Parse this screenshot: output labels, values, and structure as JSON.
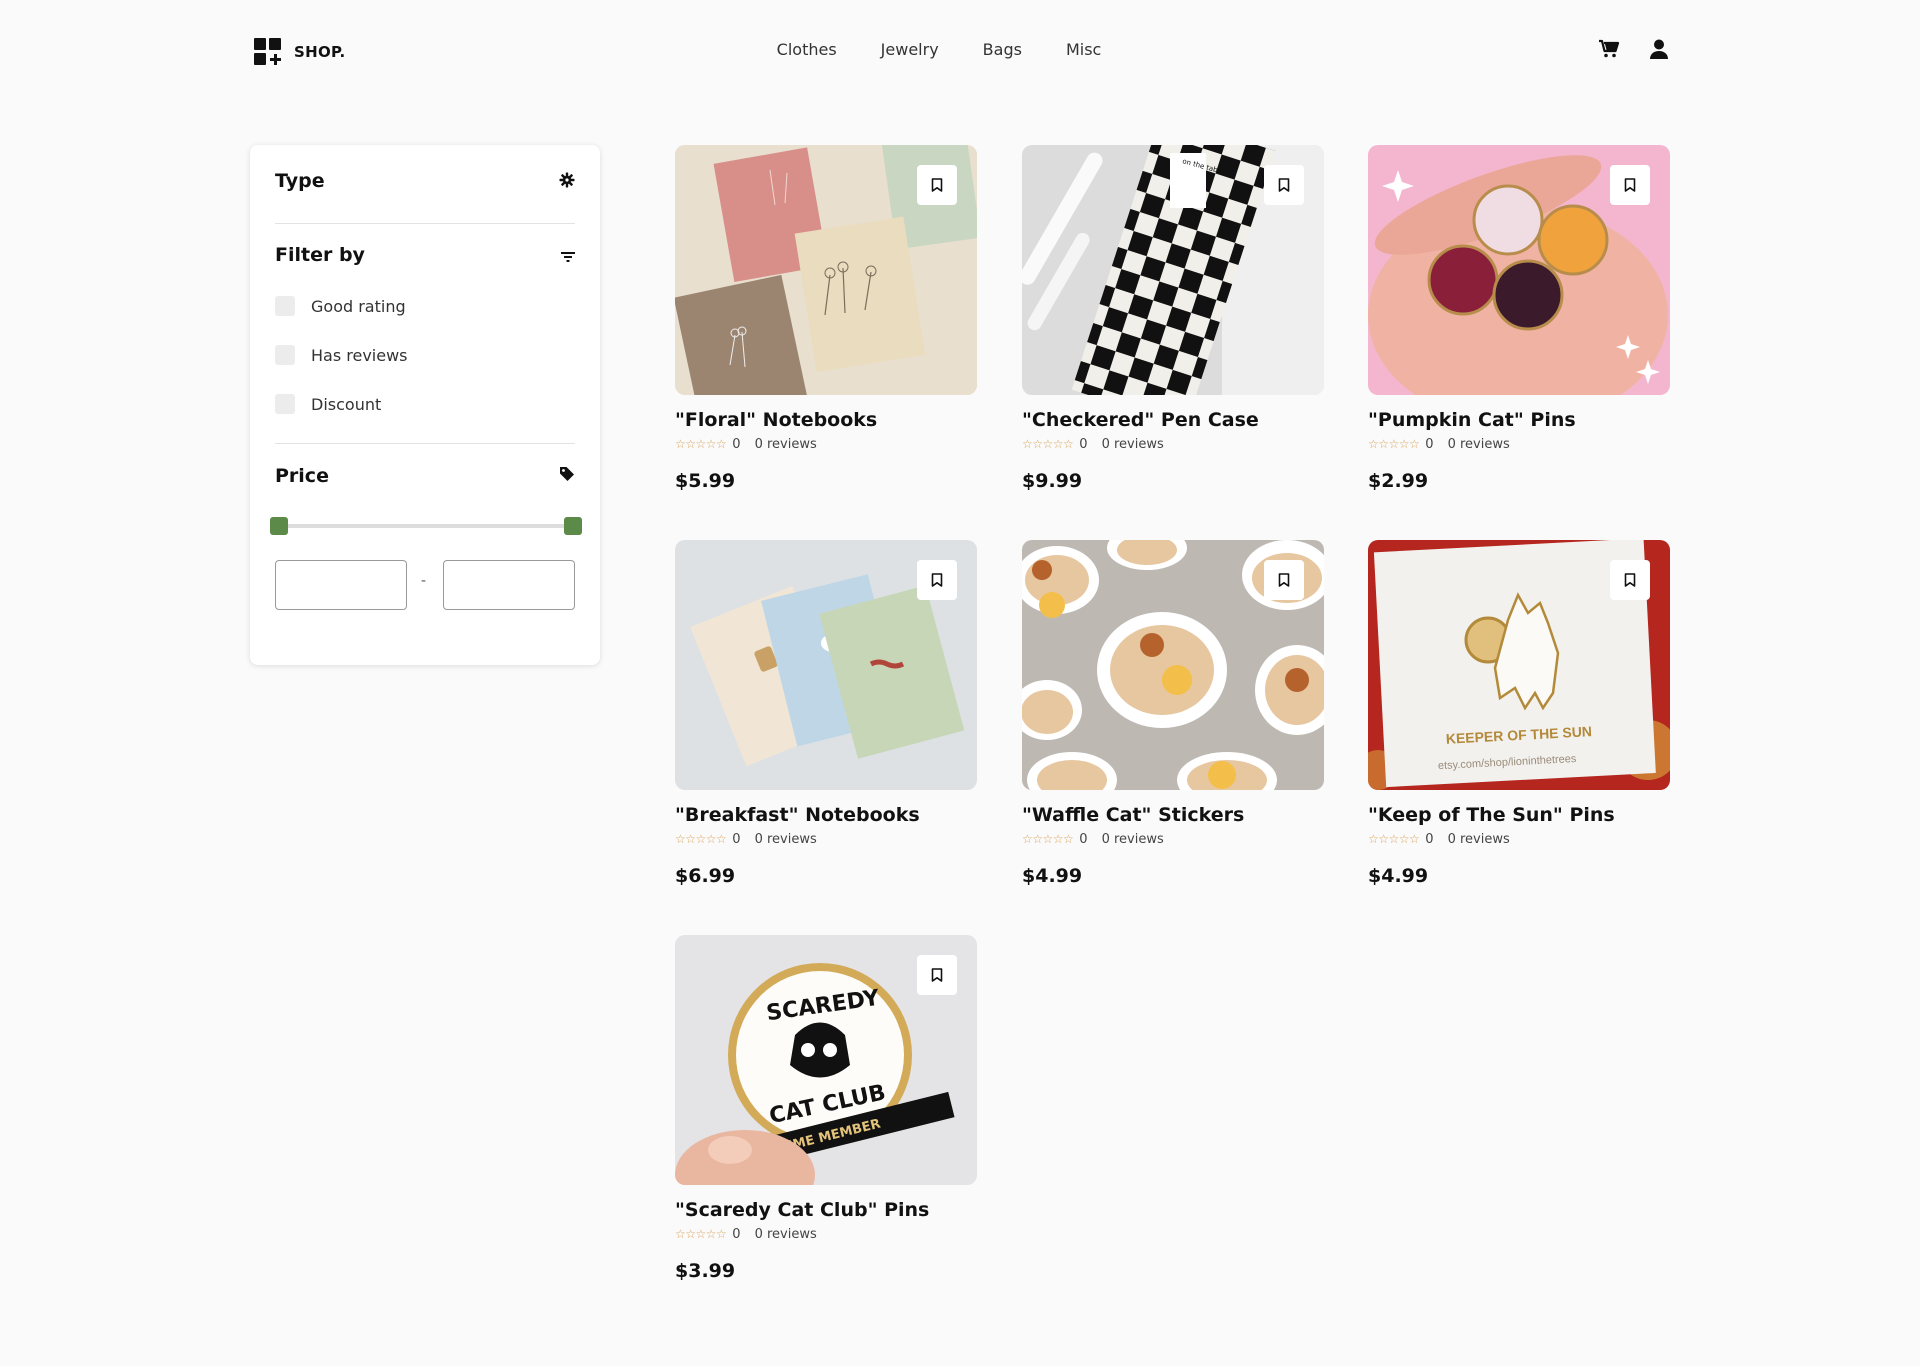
{
  "brand": {
    "name": "SHOP."
  },
  "nav": {
    "items": [
      "Clothes",
      "Jewelry",
      "Bags",
      "Misc"
    ]
  },
  "header_icons": [
    "cart-icon",
    "user-icon"
  ],
  "sidebar": {
    "type_title": "Type",
    "filter_title": "Filter by",
    "filters": [
      "Good rating",
      "Has reviews",
      "Discount"
    ],
    "price_title": "Price",
    "price_min": "",
    "price_max": "",
    "price_separator": "-"
  },
  "products": [
    {
      "title": "\"Floral\" Notebooks",
      "stars": "☆☆☆☆☆",
      "rating": "0",
      "reviews": "0 reviews",
      "price": "$5.99"
    },
    {
      "title": "\"Checkered\" Pen Case",
      "stars": "☆☆☆☆☆",
      "rating": "0",
      "reviews": "0 reviews",
      "price": "$9.99"
    },
    {
      "title": "\"Pumpkin Cat\" Pins",
      "stars": "☆☆☆☆☆",
      "rating": "0",
      "reviews": "0 reviews",
      "price": "$2.99"
    },
    {
      "title": "\"Breakfast\" Notebooks",
      "stars": "☆☆☆☆☆",
      "rating": "0",
      "reviews": "0 reviews",
      "price": "$6.99"
    },
    {
      "title": "\"Waffle Cat\" Stickers",
      "stars": "☆☆☆☆☆",
      "rating": "0",
      "reviews": "0 reviews",
      "price": "$4.99"
    },
    {
      "title": "\"Keep of The Sun\" Pins",
      "stars": "☆☆☆☆☆",
      "rating": "0",
      "reviews": "0 reviews",
      "price": "$4.99"
    },
    {
      "title": "\"Scaredy Cat Club\" Pins",
      "stars": "☆☆☆☆☆",
      "rating": "0",
      "reviews": "0 reviews",
      "price": "$3.99"
    }
  ],
  "image_text": {
    "pen_case_label": "on the table",
    "sun_card": "KEEPER OF THE SUN",
    "sun_card_url": "etsy.com/shop/lioninthetrees",
    "scaredy_top": "SCAREDY",
    "scaredy_bottom": "CAT CLUB",
    "scaredy_banner": "LIFETIME MEMBER"
  },
  "colors": {
    "accent": "#5c8a49",
    "star": "#d8a25a"
  }
}
